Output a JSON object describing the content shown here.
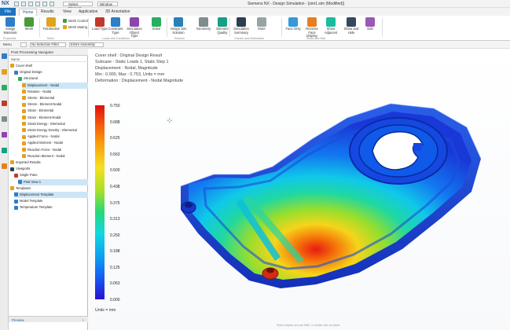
{
  "app": {
    "logo": "NX",
    "title": "Siemens NX - Design Simulation - [sim1.sim (Modified)]",
    "select_toggle": "Select Element",
    "window_menu": "Window"
  },
  "tabs": {
    "file": "File",
    "items": [
      "Home",
      "Results",
      "View",
      "Application",
      "3D Annotation"
    ]
  },
  "ribbon": {
    "buttons": [
      {
        "label": "Assign Materials",
        "icon": "assign-materials-icon",
        "color": "#2f7ec9"
      },
      {
        "label": "Mesh",
        "icon": "mesh-icon",
        "color": "#4a9a3a"
      },
      {
        "label": "Tetrahedral",
        "icon": "tetrahedral-mesh-icon",
        "color": "#e2a21e"
      },
      {
        "label": "Load Type",
        "icon": "load-icon",
        "color": "#c0392b"
      },
      {
        "label": "Constraint Type",
        "icon": "constraint-icon",
        "color": "#2f7ec9"
      },
      {
        "label": "Simulation Object Type",
        "icon": "simulation-object-icon",
        "color": "#8e44ad"
      },
      {
        "label": "Solve",
        "icon": "solve-icon",
        "color": "#27ae60"
      },
      {
        "label": "Assign Sim Solution",
        "icon": "solution-icon",
        "color": "#2980b9"
      },
      {
        "label": "Geometry",
        "icon": "geometry-icon",
        "color": "#7f8c8d"
      },
      {
        "label": "Element Quality",
        "icon": "element-quality-icon",
        "color": "#16a085"
      },
      {
        "label": "Simulation Summary",
        "icon": "simulation-summary-icon",
        "color": "#2c3e50"
      },
      {
        "label": "More",
        "icon": "more-icon",
        "color": "#95a5a6"
      },
      {
        "label": "Face Only",
        "icon": "face-only-icon",
        "color": "#3498db"
      },
      {
        "label": "Reverse Face Display",
        "icon": "reverse-face-icon",
        "color": "#e67e22"
      },
      {
        "label": "Show Adjacent",
        "icon": "show-adjacent-icon",
        "color": "#1abc9c"
      },
      {
        "label": "Show and Hide",
        "icon": "show-hide-icon",
        "color": "#34495e"
      },
      {
        "label": "Edit",
        "icon": "edit-icon",
        "color": "#9b59b6"
      }
    ],
    "small": [
      "Mesh Control",
      "Mesh Mating"
    ],
    "groups": [
      "Properties",
      "Mesh",
      "Loads and Conditions",
      "Solution",
      "Checks and Information",
      "Show and Hide"
    ]
  },
  "toolbar": {
    "menu": "Menu",
    "filter": "No Selection Filter",
    "scope": "Entire Assembly"
  },
  "navigator": {
    "title": "Post Processing Navigator",
    "column": "Name",
    "nodes": [
      {
        "label": "Cover shell",
        "level": 0,
        "icon": "folder-icon",
        "color": "#e2a21e"
      },
      {
        "label": "Original Design",
        "level": 1,
        "icon": "solution-icon",
        "color": "#2f7ec9"
      },
      {
        "label": "Structural",
        "level": 2,
        "icon": "results-icon",
        "color": "#27ae60"
      },
      {
        "label": "Displacement - Nodal",
        "level": 3,
        "icon": "result-icon",
        "color": "#e2a21e",
        "selected": true
      },
      {
        "label": "Rotation - Nodal",
        "level": 3,
        "icon": "result-icon",
        "color": "#e2a21e"
      },
      {
        "label": "Stress - Elemental",
        "level": 3,
        "icon": "result-icon",
        "color": "#e2a21e"
      },
      {
        "label": "Stress - Element-Nodal",
        "level": 3,
        "icon": "result-icon",
        "color": "#e2a21e"
      },
      {
        "label": "Strain - Elemental",
        "level": 3,
        "icon": "result-icon",
        "color": "#e2a21e"
      },
      {
        "label": "Strain - Element-Nodal",
        "level": 3,
        "icon": "result-icon",
        "color": "#e2a21e"
      },
      {
        "label": "Strain Energy - Elemental",
        "level": 3,
        "icon": "result-icon",
        "color": "#e2a21e"
      },
      {
        "label": "Strain Energy Density - Elemental",
        "level": 3,
        "icon": "result-icon",
        "color": "#e2a21e"
      },
      {
        "label": "Applied Force - Nodal",
        "level": 3,
        "icon": "result-icon",
        "color": "#e2a21e"
      },
      {
        "label": "Applied Moment - Nodal",
        "level": 3,
        "icon": "result-icon",
        "color": "#e2a21e"
      },
      {
        "label": "Reaction Force - Nodal",
        "level": 3,
        "icon": "result-icon",
        "color": "#e2a21e"
      },
      {
        "label": "Reaction Moment - Nodal",
        "level": 3,
        "icon": "result-icon",
        "color": "#e2a21e"
      },
      {
        "label": "Imported Results",
        "level": 0,
        "icon": "folder-icon",
        "color": "#e2a21e"
      },
      {
        "label": "Viewports",
        "level": 0,
        "icon": "viewport-icon",
        "color": "#2c3e50"
      },
      {
        "label": "Single Pane",
        "level": 1,
        "icon": "pane-icon",
        "color": "#c0392b"
      },
      {
        "label": "Post View 1",
        "level": 2,
        "icon": "post-view-icon",
        "color": "#2f7ec9",
        "selected": true
      },
      {
        "label": "Templates",
        "level": 0,
        "icon": "folder-icon",
        "color": "#e2a21e"
      },
      {
        "label": "Displacement Template",
        "level": 1,
        "icon": "template-icon",
        "color": "#2f7ec9",
        "selected": true
      },
      {
        "label": "Model Template",
        "level": 1,
        "icon": "template-icon",
        "color": "#2f7ec9"
      },
      {
        "label": "Temperature Template",
        "level": 1,
        "icon": "template-icon",
        "color": "#2f7ec9"
      }
    ],
    "preview": "Preview"
  },
  "viewport": {
    "header": [
      "Cover shell : Original Design Result",
      "Subcase - Static Loads 1, Static Step 1",
      "Displacement - Nodal, Magnitude",
      "Min : 0.000, Max : 0.753, Units = mm",
      "Deformation : Displacement - Nodal Magnitude"
    ],
    "legend": [
      "0.750",
      "0.688",
      "0.625",
      "0.563",
      "0.500",
      "0.438",
      "0.375",
      "0.313",
      "0.250",
      "0.188",
      "0.125",
      "0.063",
      "0.000"
    ],
    "units": "Units = mm",
    "status": "Select objects and use MB3, or double-click an object"
  }
}
